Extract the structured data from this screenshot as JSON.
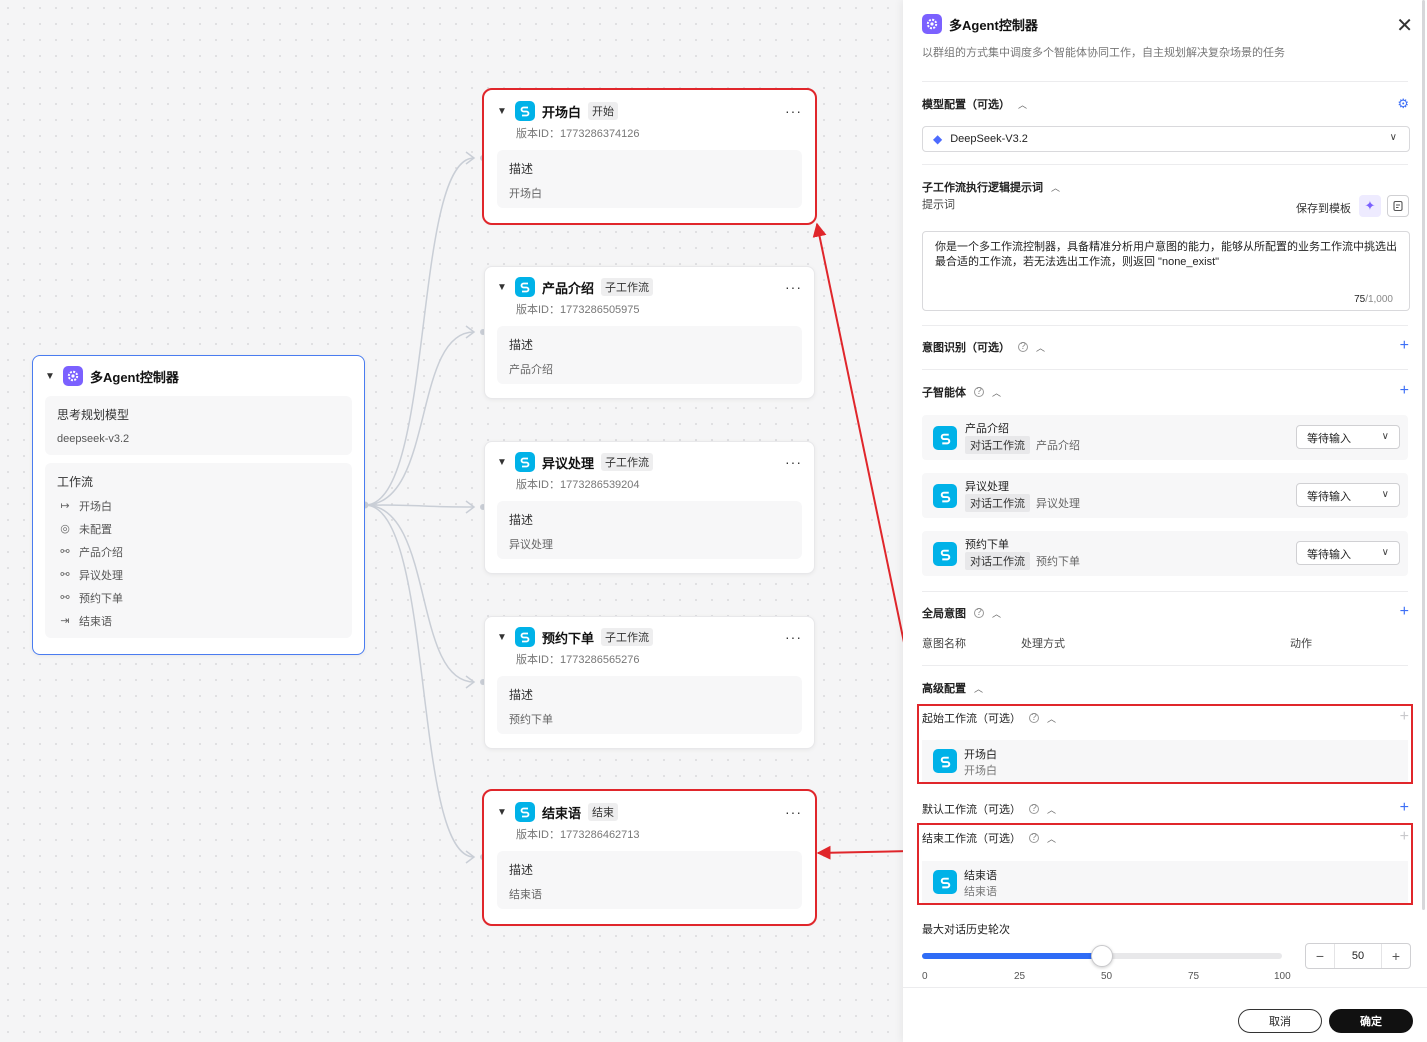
{
  "canvas": {
    "controller": {
      "title": "多Agent控制器",
      "model_label": "思考规划模型",
      "model_value": "deepseek-v3.2",
      "workflow_label": "工作流",
      "workflows": [
        {
          "icon": "start-arrow-icon",
          "label": "开场白"
        },
        {
          "icon": "location-pin-icon",
          "label": "未配置"
        },
        {
          "icon": "branch-icon",
          "label": "产品介绍"
        },
        {
          "icon": "branch-icon",
          "label": "异议处理"
        },
        {
          "icon": "branch-icon",
          "label": "预约下单"
        },
        {
          "icon": "end-arrow-icon",
          "label": "结束语"
        }
      ]
    },
    "nodes": [
      {
        "title": "开场白",
        "tag": "开始",
        "version": "版本ID：1773286374126",
        "desc_label": "描述",
        "desc": "开场白",
        "highlighted": true
      },
      {
        "title": "产品介绍",
        "tag": "子工作流",
        "version": "版本ID：1773286505975",
        "desc_label": "描述",
        "desc": "产品介绍",
        "highlighted": false
      },
      {
        "title": "异议处理",
        "tag": "子工作流",
        "version": "版本ID：1773286539204",
        "desc_label": "描述",
        "desc": "异议处理",
        "highlighted": false
      },
      {
        "title": "预约下单",
        "tag": "子工作流",
        "version": "版本ID：1773286565276",
        "desc_label": "描述",
        "desc": "预约下单",
        "highlighted": false
      },
      {
        "title": "结束语",
        "tag": "结束",
        "version": "版本ID：1773286462713",
        "desc_label": "描述",
        "desc": "结束语",
        "highlighted": true
      }
    ]
  },
  "panel": {
    "title": "多Agent控制器",
    "subtitle": "以群组的方式集中调度多个智能体协同工作，自主规划解决复杂场景的任务",
    "model_section": "模型配置（可选）",
    "model_selected": "DeepSeek-V3.2",
    "prompt_section": "子工作流执行逻辑提示词",
    "prompt_label": "提示词",
    "save_template": "保存到模板",
    "prompt_text": "你是一个多工作流控制器，具备精准分析用户意图的能力，能够从所配置的业务工作流中挑选出最合适的工作流，若无法选出工作流，则返回 \"none_exist\"",
    "prompt_count": "75",
    "prompt_max": "/1,000",
    "intent_section": "意图识别（可选）",
    "sub_agent_section": "子智能体",
    "sub_agents": [
      {
        "name": "产品介绍",
        "tag": "对话工作流",
        "desc": "产品介绍",
        "mode": "等待输入"
      },
      {
        "name": "异议处理",
        "tag": "对话工作流",
        "desc": "异议处理",
        "mode": "等待输入"
      },
      {
        "name": "预约下单",
        "tag": "对话工作流",
        "desc": "预约下单",
        "mode": "等待输入"
      }
    ],
    "global_intent_section": "全局意图",
    "global_cols": [
      "意图名称",
      "处理方式",
      "动作"
    ],
    "advanced_section": "高级配置",
    "start_wf_section": "起始工作流（可选）",
    "start_wf": {
      "name": "开场白",
      "desc": "开场白"
    },
    "default_wf_section": "默认工作流（可选）",
    "end_wf_section": "结束工作流（可选）",
    "end_wf": {
      "name": "结束语",
      "desc": "结束语"
    },
    "history_section": "最大对话历史轮次",
    "history_value": 50,
    "history_value_text": "50",
    "slider": {
      "min": 0,
      "max": 100,
      "value": 50
    },
    "ticks": [
      "0",
      "25",
      "50",
      "75",
      "100"
    ],
    "cancel": "取消",
    "confirm": "确定"
  },
  "colors": {
    "accent": "#2f6cf6",
    "highlight": "#e0262b",
    "controller_icon": "#7b61ff",
    "workflow_icon": "#00b2e8"
  }
}
